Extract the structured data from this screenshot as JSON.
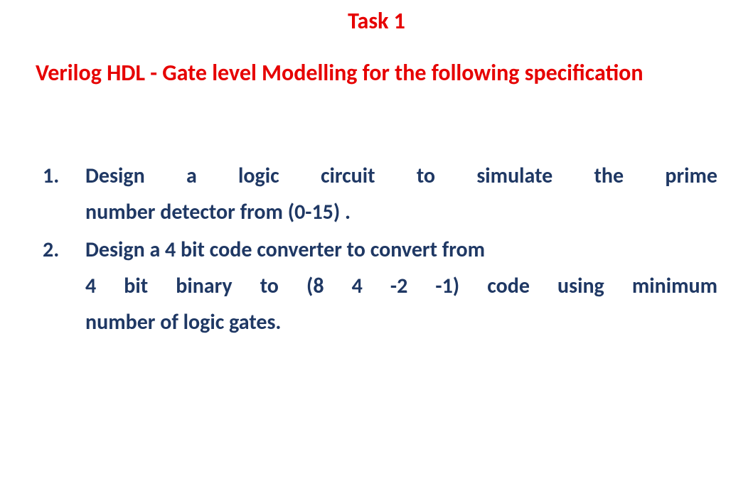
{
  "title": "Task 1",
  "subtitle": "Verilog HDL - Gate level Modelling for the following specification",
  "items": [
    {
      "number": "1.",
      "line1": "Design a logic circuit to simulate the prime",
      "line2": "number detector from (0-15) ."
    },
    {
      "number": "2.",
      "line1": "Design a 4 bit code converter to convert from",
      "line2": "4 bit binary to (8 4 -2 -1) code using minimum",
      "line3": "number of logic gates."
    }
  ]
}
